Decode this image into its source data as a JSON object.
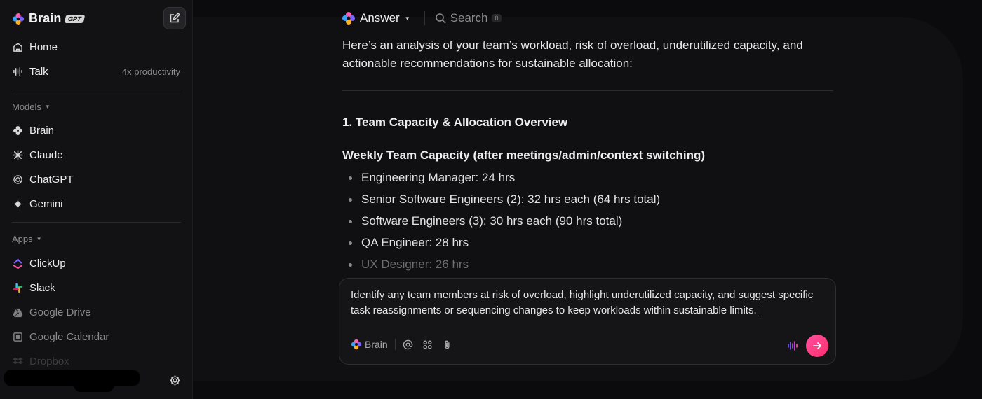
{
  "brand": {
    "name": "Brain",
    "badge": "GPT"
  },
  "nav": {
    "home": "Home",
    "talk": "Talk",
    "talk_aside": "4x productivity"
  },
  "models": {
    "label": "Models",
    "items": [
      "Brain",
      "Claude",
      "ChatGPT",
      "Gemini"
    ]
  },
  "apps": {
    "label": "Apps",
    "items": [
      "ClickUp",
      "Slack",
      "Google Drive",
      "Google Calendar",
      "Dropbox"
    ]
  },
  "topbar": {
    "mode": "Answer",
    "search": "Search",
    "search_count": "0"
  },
  "answer": {
    "intro": "Here’s an analysis of your team’s workload, risk of overload, underutilized capacity, and actionable recommendations for sustainable allocation:",
    "section_title": "1. Team Capacity & Allocation Overview",
    "subsection_title": "Weekly Team Capacity (after meetings/admin/context switching)",
    "bullets": [
      "Engineering Manager: 24 hrs",
      "Senior Software Engineers (2): 32 hrs each (64 hrs total)",
      "Software Engineers (3): 30 hrs each (90 hrs total)",
      "QA Engineer: 28 hrs",
      "UX Designer: 26 hrs"
    ]
  },
  "composer": {
    "text": "Identify any team members at risk of overload, highlight underutilized capacity, and suggest specific task reassignments or sequencing changes to keep workloads within sustainable limits.",
    "model": "Brain"
  },
  "colors": {
    "accent_send": "#ff3f7f",
    "sidebar_bg": "#121214",
    "panel_bg": "#101012"
  }
}
